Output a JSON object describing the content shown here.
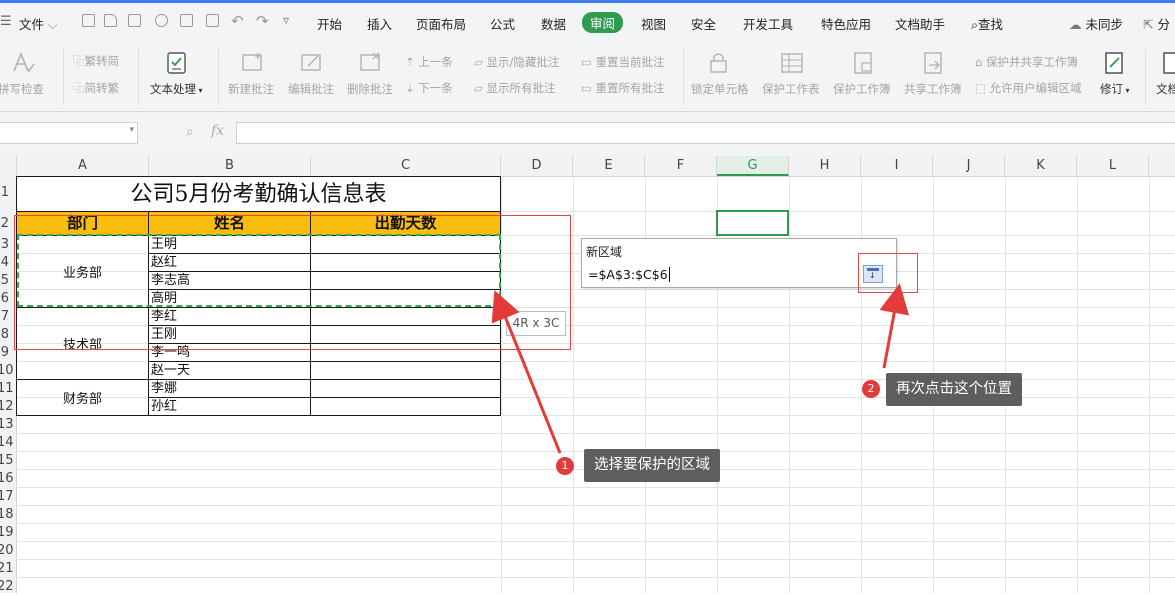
{
  "menubar": {
    "file_label": "文件",
    "tabs": [
      "开始",
      "插入",
      "页面布局",
      "公式",
      "数据",
      "审阅",
      "视图",
      "安全",
      "开发工具",
      "特色应用",
      "文档助手"
    ],
    "active_tab": "审阅",
    "search_label": "查找",
    "sync_label": "未同步",
    "share_label": "分"
  },
  "ribbon": {
    "spell_check": "拼写检查",
    "trad_to_simp": "繁转简",
    "simp_to_trad": "简转繁",
    "text_process": "文本处理",
    "new_comment": "新建批注",
    "edit_comment": "编辑批注",
    "delete_comment": "删除批注",
    "prev_item": "上一条",
    "next_item": "下一条",
    "show_hide_comments": "显示/隐藏批注",
    "show_all_comments": "显示所有批注",
    "reset_current_comment": "重置当前批注",
    "reset_all_comments": "重置所有批注",
    "lock_cell": "锁定单元格",
    "protect_sheet": "保护工作表",
    "protect_workbook": "保护工作簿",
    "share_workbook": "共享工作簿",
    "protect_share_workbook": "保护并共享工作簿",
    "allow_user_edit": "允许用户编辑区域",
    "track_changes": "修订",
    "doc_compare": "文档"
  },
  "formula_bar": {
    "fx": "fx"
  },
  "columns": [
    "A",
    "B",
    "C",
    "D",
    "E",
    "F",
    "G",
    "H",
    "I",
    "J",
    "K",
    "L"
  ],
  "rows": [
    "1",
    "2",
    "3",
    "4",
    "5",
    "6",
    "7",
    "8",
    "9",
    "10",
    "11",
    "12",
    "13",
    "14",
    "15",
    "16",
    "17",
    "18",
    "19",
    "20",
    "21",
    "22"
  ],
  "sheet": {
    "title": "公司5月份考勤确认信息表",
    "headers": [
      "部门",
      "姓名",
      "出勤天数"
    ],
    "departments": [
      "业务部",
      "技术部",
      "财务部"
    ],
    "names": [
      "王明",
      "赵红",
      "李志高",
      "高明",
      "李红",
      "王刚",
      "李一鸣",
      "赵一天",
      "李娜",
      "孙红"
    ]
  },
  "selection_size_tip": "4R x 3C",
  "dialog": {
    "title": "新区域",
    "range_value": "=$A$3:$C$6"
  },
  "callouts": [
    {
      "number": "1",
      "text": "选择要保护的区域"
    },
    {
      "number": "2",
      "text": "再次点击这个位置"
    }
  ],
  "colors": {
    "accent_green": "#2e9b4f",
    "header_fill": "#fbbd0d",
    "annotation_red": "#e24646"
  }
}
